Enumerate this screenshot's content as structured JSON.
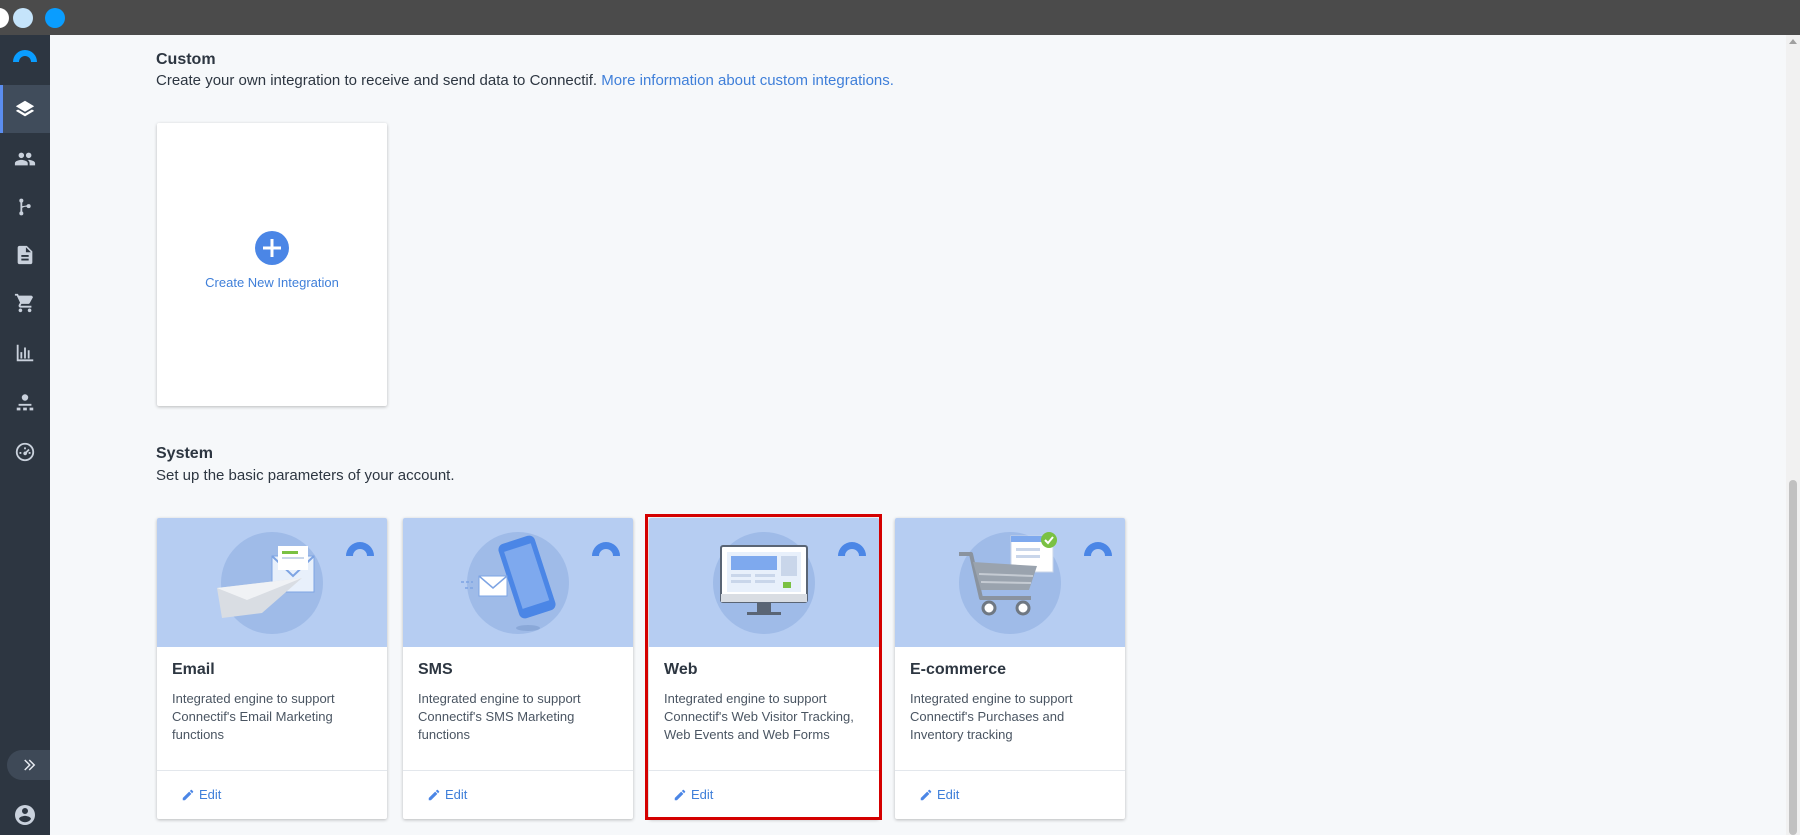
{
  "colors": {
    "accent": "#4b86e6",
    "link": "#3f7fd9",
    "sidebar": "#2d3641",
    "banner": "#b6cdf2",
    "highlight": "#d40000"
  },
  "sidebar": {
    "items": [
      {
        "icon": "layers-icon",
        "active": true
      },
      {
        "icon": "contacts-icon",
        "active": false
      },
      {
        "icon": "workflow-icon",
        "active": false
      },
      {
        "icon": "document-icon",
        "active": false
      },
      {
        "icon": "cart-icon",
        "active": false
      },
      {
        "icon": "bar-chart-icon",
        "active": false
      },
      {
        "icon": "user-group-icon",
        "active": false
      },
      {
        "icon": "speedometer-icon",
        "active": false
      }
    ]
  },
  "custom": {
    "title": "Custom",
    "description": "Create your own integration to receive and send data to Connectif.",
    "link": "More information about custom integrations.",
    "create_label": "Create New Integration"
  },
  "system": {
    "title": "System",
    "description": "Set up the basic parameters of your account.",
    "cards": [
      {
        "title": "Email",
        "description": "Integrated engine to support Connectif's Email Marketing functions",
        "edit": "Edit",
        "illustration": "paper-plane-envelope"
      },
      {
        "title": "SMS",
        "description": "Integrated engine to support Connectif's SMS Marketing functions",
        "edit": "Edit",
        "illustration": "phone-message"
      },
      {
        "title": "Web",
        "description": "Integrated engine to support Connectif's Web Visitor Tracking, Web Events and Web Forms",
        "edit": "Edit",
        "illustration": "desktop-monitor"
      },
      {
        "title": "E-commerce",
        "description": "Integrated engine to support Connectif's Purchases and Inventory tracking",
        "edit": "Edit",
        "illustration": "shopping-cart"
      }
    ]
  }
}
